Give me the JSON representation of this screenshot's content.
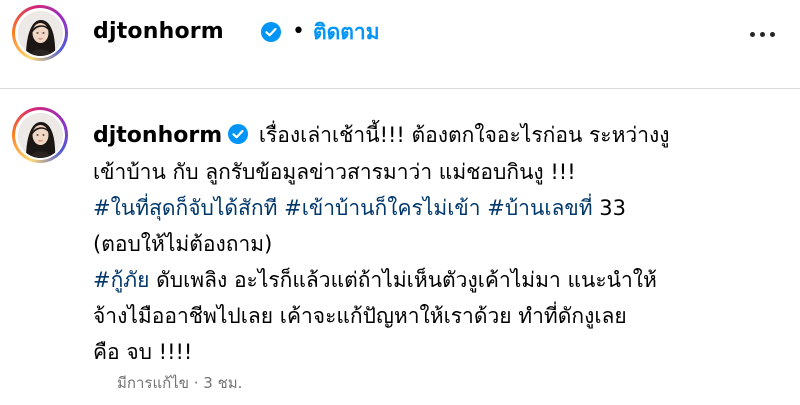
{
  "header": {
    "username": "djtonhorm",
    "separator": "•",
    "follow_label": "ติดตาม",
    "more_icon": "more-horizontal-icon"
  },
  "caption": {
    "username": "djtonhorm",
    "line1": "เรื่องเล่าเช้านี้!!! ต้องตกใจอะไรก่อน ระหว่างงู",
    "line2": "เข้าบ้าน กับ ลูกรับข้อมูลข่าวสารมาว่า แม่ชอบกินงู !!!",
    "hashtag1": "#ในที่สุดก็จับได้สักที",
    "hashtag2": "#เข้าบ้านก็ใครไม่เข้า",
    "hashtag3": "#บ้านเลขที่",
    "number": "33",
    "line4": "(ตอบให้ไม่ต้องถาม)",
    "hashtag4": "#กู้ภัย",
    "line5_rest": "ดับเพลิง อะไรก็แล้วแต่ถ้าไม่เห็นตัวงูเค้าไม่มา แนะนำให้",
    "line6": "จ้างไมืออาชีพไปเลย เค้าจะแก้ปัญหาให้เราด้วย ทำที่ดักงูเลย",
    "line7": "คือ จบ !!!!"
  },
  "meta": {
    "edited_label": "มีการแก้ไข · 3 ชม."
  },
  "colors": {
    "link_blue": "#0095f6",
    "hashtag": "#00376b",
    "muted": "#737373",
    "divider": "#dbdbdb"
  }
}
